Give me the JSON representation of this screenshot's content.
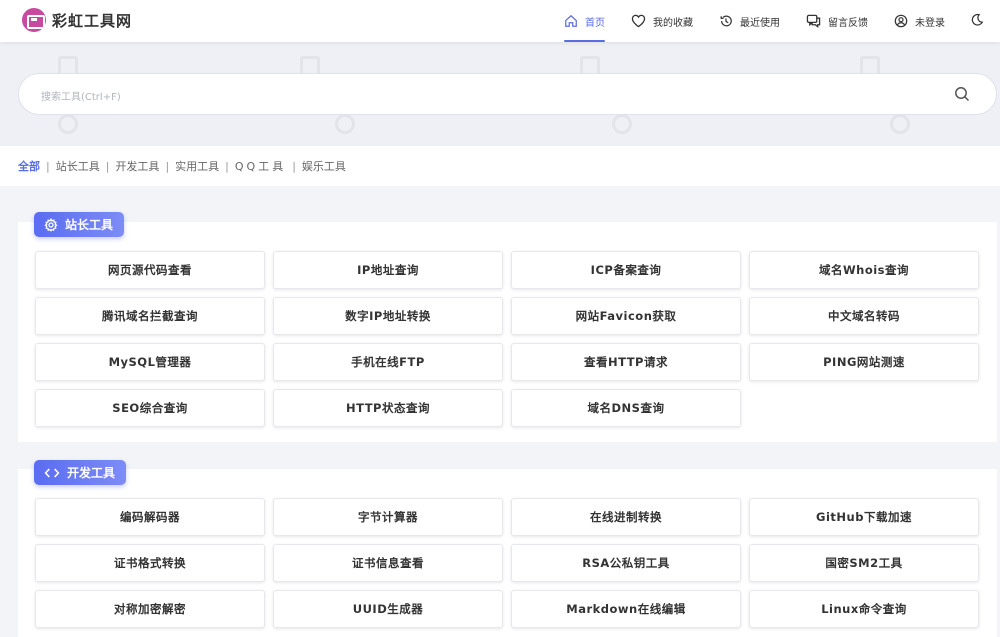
{
  "header": {
    "logo_text": "彩虹工具网",
    "brand_color": "#c84aa0",
    "accent_color": "#5b6ee1",
    "nav": [
      {
        "label": "首页",
        "icon": "home-icon",
        "active": true
      },
      {
        "label": "我的收藏",
        "icon": "heart-icon",
        "active": false
      },
      {
        "label": "最近使用",
        "icon": "history-icon",
        "active": false
      },
      {
        "label": "留言反馈",
        "icon": "chat-icon",
        "active": false
      },
      {
        "label": "未登录",
        "icon": "user-icon",
        "active": false
      }
    ]
  },
  "search": {
    "placeholder": "搜索工具(Ctrl+F)"
  },
  "filter": {
    "items": [
      "全部",
      "站长工具",
      "开发工具",
      "实用工具",
      "QQ工具",
      "娱乐工具"
    ],
    "active_index": 0
  },
  "sections": [
    {
      "title": "站长工具",
      "icon": "gear-icon",
      "tools": [
        "网页源代码查看",
        "IP地址查询",
        "ICP备案查询",
        "域名Whois查询",
        "腾讯域名拦截查询",
        "数字IP地址转换",
        "网站Favicon获取",
        "中文域名转码",
        "MySQL管理器",
        "手机在线FTP",
        "查看HTTP请求",
        "PING网站测速",
        "SEO综合查询",
        "HTTP状态查询",
        "域名DNS查询"
      ]
    },
    {
      "title": "开发工具",
      "icon": "code-icon",
      "tools": [
        "编码解码器",
        "字节计算器",
        "在线进制转换",
        "GitHub下载加速",
        "证书格式转换",
        "证书信息查看",
        "RSA公私钥工具",
        "国密SM2工具",
        "对称加密解密",
        "UUID生成器",
        "Markdown在线编辑",
        "Linux命令查询"
      ]
    }
  ]
}
